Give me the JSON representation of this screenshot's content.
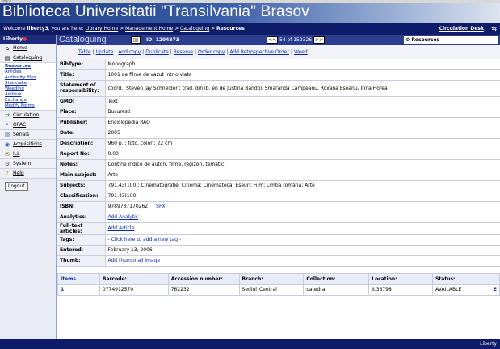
{
  "banner": {
    "title": "Biblioteca Universitatii \"Transilvania\" Brasov"
  },
  "welcome": {
    "prefix": "Welcome ",
    "user": "liberty3",
    "mid": ", you are here: ",
    "crumbs": [
      "Library Home",
      "Management Home",
      "Cataloguing",
      "Resources"
    ],
    "sep": " > ",
    "circulation_desk": "Circulation Desk"
  },
  "sidebar": {
    "logo": "Liberty",
    "items": [
      {
        "label": "Home",
        "icon": "home-icon",
        "glyph": "⌂"
      },
      {
        "label": "Cataloguing",
        "icon": "book-icon",
        "glyph": "▤"
      }
    ],
    "sub": [
      "Resources",
      "Articles",
      "Authority files",
      "Stocktake",
      "Weeding",
      "Archive",
      "Exchange",
      "Modify Forms"
    ],
    "items2": [
      {
        "label": "Circulation",
        "icon": "circulation-icon",
        "glyph": "⇄"
      },
      {
        "label": "OPAC",
        "icon": "opac-icon",
        "glyph": "⌕"
      },
      {
        "label": "Serials",
        "icon": "serials-icon",
        "glyph": "▥"
      },
      {
        "label": "Acquisitions",
        "icon": "acquisitions-icon",
        "glyph": "◉"
      },
      {
        "label": "ILL",
        "icon": "ill-icon",
        "glyph": "✉"
      },
      {
        "label": "System",
        "icon": "system-icon",
        "glyph": "⚙"
      },
      {
        "label": "Help",
        "icon": "help-icon",
        "glyph": "?"
      }
    ],
    "logout": "Logout"
  },
  "modbar": {
    "title": "Cataloguing",
    "id_text": "ID: 1204373",
    "prev": "<<",
    "next": ">>",
    "pager": "54 of 152326",
    "search_label": "Resources"
  },
  "actions": [
    "Table",
    "Update",
    "Add copy",
    "Duplicate",
    "Reserve",
    "Order copy",
    "Add Retrospective Order",
    "Weed"
  ],
  "fields": [
    {
      "label": "BibType:",
      "value": "Monograph"
    },
    {
      "label": "Title:",
      "value": "1001 de filme de vazut intr-o viata"
    },
    {
      "label": "Statement of responsibility:",
      "value": "coord.: Steven Jay Schneider ; trad. din lb. en de Justina Bandol, Smaranda Campeanu, Roxana Eseanu, Irina Horea"
    },
    {
      "label": "GMD:",
      "value": "Text"
    },
    {
      "label": "Place:",
      "value": "Bucuresti"
    },
    {
      "label": "Publisher:",
      "value": "Enciclopedia RAO"
    },
    {
      "label": "Date:",
      "value": "2005"
    },
    {
      "label": "Description:",
      "value": "960 p. : foto. color ; 22 cm"
    },
    {
      "label": "Report No:",
      "value": "0.00"
    },
    {
      "label": "Notes:",
      "value": "Contine indice de autori, filme, regizori, tematic."
    },
    {
      "label": "Main subject:",
      "value": "Arte"
    },
    {
      "label": "Subjects:",
      "value": "791.43(100); Cinematografie; Cinema; Cinemateca; Eseuri; Film; Limba română; Arte"
    },
    {
      "label": "Classification:",
      "value": "791.43(100)"
    },
    {
      "label": "ISBN:",
      "value": "9789737170262",
      "extra": "SFX"
    },
    {
      "label": "Analytics:",
      "value": "Add Analytic",
      "link": true
    },
    {
      "label": "Full-text articles:",
      "value": "Add Article",
      "link": true
    },
    {
      "label": "Tags:",
      "value": "- Click here to add a new tag -",
      "link": true,
      "nounderline": true
    },
    {
      "label": "Entered:",
      "value": "February 13, 2006"
    },
    {
      "label": "Thumb:",
      "value": "Add thumbnail image",
      "link": true
    }
  ],
  "items": {
    "headers": [
      "Items",
      "Barcode:",
      "Accession number:",
      "Branch:",
      "Collection:",
      "Location:",
      "Status:",
      ""
    ],
    "rows": [
      [
        "1",
        "0774912570",
        "762232",
        "Sediul_Central",
        "catedra",
        "II.38798",
        "AVAILABLE",
        "E"
      ]
    ]
  },
  "footer": {
    "logo": "Liberty"
  }
}
